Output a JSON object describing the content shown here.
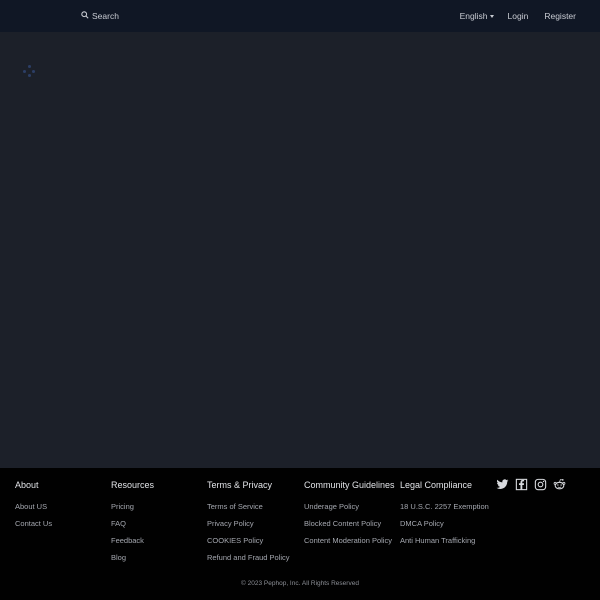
{
  "header": {
    "search_label": "Search",
    "language": "English",
    "login_label": "Login",
    "register_label": "Register"
  },
  "main": {
    "loader_icon": "loading-spinner-icon"
  },
  "footer": {
    "columns": [
      {
        "title": "About",
        "links": [
          "About US",
          "Contact Us"
        ]
      },
      {
        "title": "Resources",
        "links": [
          "Pricing",
          "FAQ",
          "Feedback",
          "Blog"
        ]
      },
      {
        "title": "Terms & Privacy",
        "links": [
          "Terms of Service",
          "Privacy Policy",
          "COOKIES Policy",
          "Refund and Fraud Policy"
        ]
      },
      {
        "title": "Community Guidelines",
        "links": [
          "Underage Policy",
          "Blocked Content Policy",
          "Content Moderation Policy"
        ]
      },
      {
        "title": "Legal Compliance",
        "links": [
          "18 U.S.C. 2257 Exemption",
          "DMCA Policy",
          "Anti Human Trafficking"
        ]
      }
    ],
    "social_icons": [
      "twitter-icon",
      "facebook-icon",
      "instagram-icon",
      "reddit-icon"
    ],
    "copyright": "© 2023 Pephop, Inc. All Rights Reserved"
  },
  "colors": {
    "header_bg": "#101725",
    "main_bg": "#1c2029",
    "footer_bg": "#010101",
    "loader": "#2c3e66"
  }
}
